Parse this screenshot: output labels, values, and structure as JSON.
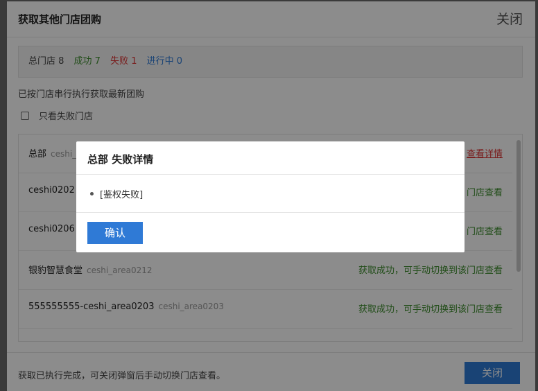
{
  "modal": {
    "title": "获取其他门店团购",
    "close_label": "关闭"
  },
  "summary": {
    "total": "总门店 8",
    "success": "成功 7",
    "fail": "失败 1",
    "running": "进行中 0"
  },
  "note": "已按门店串行执行获取最新团购",
  "filter_label": "只看失败门店",
  "rows": [
    {
      "name": "总部",
      "code": "ceshi_",
      "status": "查看详情"
    },
    {
      "name": "ceshi0202",
      "code": "",
      "status": "门店查看"
    },
    {
      "name": "ceshi0206",
      "code": "",
      "status": "门店查看"
    },
    {
      "name": "银豹智慧食堂",
      "code": "ceshi_area0212",
      "status": "获取成功，可手动切换到该门店查看"
    },
    {
      "name": "555555555-ceshi_area0203",
      "code": "ceshi_area0203",
      "status": "获取成功，可手动切换到该门店查看"
    }
  ],
  "footer": {
    "text": "获取已执行完成，可关闭弹窗后手动切换门店查看。",
    "close_button": "关闭"
  },
  "dialog": {
    "title": "总部 失败详情",
    "items": [
      "[鉴权失败]"
    ],
    "confirm_button": "确认"
  },
  "colors": {
    "primary": "#2f7ad6",
    "success": "#3c8c2c",
    "fail": "#dd3333"
  }
}
